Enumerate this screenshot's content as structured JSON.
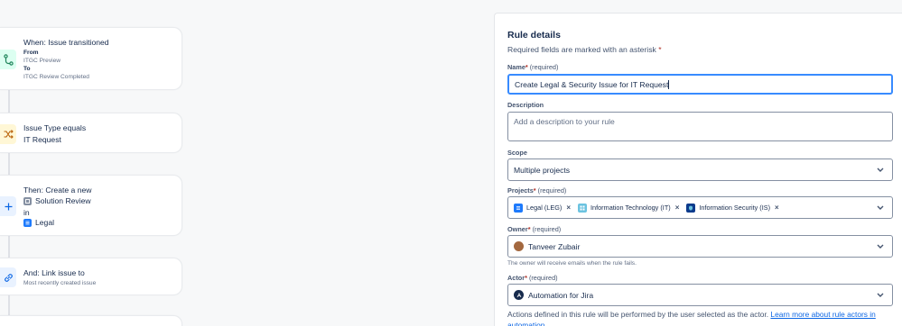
{
  "flow": {
    "trigger": {
      "title": "When: Issue transitioned",
      "from_label": "From",
      "from_value": "ITGC Preview",
      "to_label": "To",
      "to_value": "ITGC Review Completed",
      "icon": "transition-icon"
    },
    "condition": {
      "title": "Issue Type equals",
      "value": "IT Request",
      "icon": "shuffle-icon"
    },
    "action": {
      "title": "Then: Create a new",
      "issue_type": "Solution Review",
      "in_label": "in",
      "project": "Legal",
      "icon": "plus-icon"
    },
    "branch": {
      "title": "And: Link issue to",
      "subtitle": "Most recently created issue",
      "icon": "link-icon"
    }
  },
  "details": {
    "heading": "Rule details",
    "required_note": "Required fields are marked with an asterisk",
    "asterisk": "*",
    "name": {
      "label": "Name",
      "required": "(required)",
      "value": "Create Legal & Security Issue for IT Request"
    },
    "description": {
      "label": "Description",
      "placeholder": "Add a description to your rule"
    },
    "scope": {
      "label": "Scope",
      "value": "Multiple projects"
    },
    "projects": {
      "label": "Projects",
      "required": "(required)",
      "items": [
        {
          "label": "Legal (LEG)",
          "color": "#1d7afc"
        },
        {
          "label": "Information Technology (IT)",
          "color": "#6cc3e0"
        },
        {
          "label": "Information Security (IS)",
          "color": "#0c3b8c"
        }
      ]
    },
    "owner": {
      "label": "Owner",
      "required": "(required)",
      "value": "Tanveer Zubair",
      "helper": "The owner will receive emails when the rule fails."
    },
    "actor": {
      "label": "Actor",
      "required": "(required)",
      "value": "Automation for Jira"
    },
    "actor_note": "Actions defined in this rule will be performed by the user selected as the actor.",
    "actor_link": "Learn more about rule actors in automation."
  },
  "colors": {
    "accent": "#388bff",
    "required": "#ae2e24",
    "link": "#0c66e4"
  }
}
